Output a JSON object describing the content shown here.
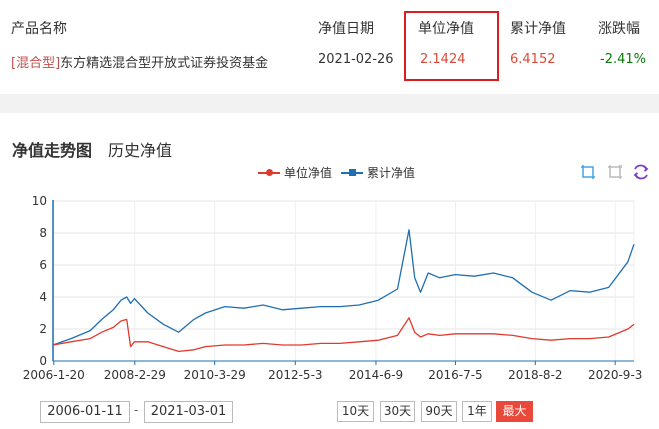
{
  "fund_table": {
    "headers": {
      "name": "产品名称",
      "date": "净值日期",
      "unit_nav": "单位净值",
      "acc_nav": "累计净值",
      "change": "涨跌幅"
    },
    "row": {
      "tag": "[混合型]",
      "name": "东方精选混合型开放式证券投资基金",
      "date": "2021-02-26",
      "unit_nav": "2.1424",
      "acc_nav": "6.4152",
      "change": "-2.41%"
    }
  },
  "chart_section": {
    "title": "净值走势图",
    "history_link": "历史净值"
  },
  "legend": {
    "unit": "单位净值",
    "acc": "累计净值"
  },
  "colors": {
    "unit_series": "#e03a2e",
    "acc_series": "#1f6fb2",
    "highlight_box": "#d81e1e",
    "change_negative": "#0a7a0a",
    "active_button": "#e8493b"
  },
  "toolbar_icons": [
    "zoom-icon",
    "zoom-reset-icon",
    "restore-icon"
  ],
  "date_range": {
    "start": "2006-01-11",
    "separator": "-",
    "end": "2021-03-01"
  },
  "range_buttons": [
    {
      "label": "10天",
      "active": false
    },
    {
      "label": "30天",
      "active": false
    },
    {
      "label": "90天",
      "active": false
    },
    {
      "label": "1年",
      "active": false
    },
    {
      "label": "最大",
      "active": true
    }
  ],
  "chart_data": {
    "type": "line",
    "ylim": [
      0,
      10
    ],
    "y_ticks": [
      "0",
      "2",
      "4",
      "6",
      "8",
      "10"
    ],
    "x_tick_labels": [
      "2006-1-20",
      "2008-2-29",
      "2010-3-29",
      "2012-5-3",
      "2014-6-9",
      "2016-7-5",
      "2018-8-2",
      "2020-9-3"
    ],
    "x_tick_dates": [
      2006.05,
      2008.16,
      2010.24,
      2012.34,
      2014.44,
      2016.51,
      2018.59,
      2020.67
    ],
    "x_range": [
      2006.03,
      2021.16
    ],
    "grid": true,
    "series": [
      {
        "name": "单位净值",
        "x": [
          2006.03,
          2006.5,
          2007.0,
          2007.3,
          2007.6,
          2007.8,
          2007.95,
          2008.05,
          2008.15,
          2008.5,
          2008.9,
          2009.3,
          2009.7,
          2010.0,
          2010.5,
          2011.0,
          2011.5,
          2012.0,
          2012.5,
          2013.0,
          2013.5,
          2014.0,
          2014.5,
          2015.0,
          2015.3,
          2015.45,
          2015.6,
          2015.8,
          2016.1,
          2016.5,
          2017.0,
          2017.5,
          2018.0,
          2018.5,
          2019.0,
          2019.5,
          2020.0,
          2020.5,
          2021.0,
          2021.16
        ],
        "values": [
          1.0,
          1.2,
          1.4,
          1.8,
          2.1,
          2.5,
          2.6,
          0.9,
          1.2,
          1.2,
          0.9,
          0.6,
          0.7,
          0.9,
          1.0,
          1.0,
          1.1,
          1.0,
          1.0,
          1.1,
          1.1,
          1.2,
          1.3,
          1.6,
          2.7,
          1.8,
          1.5,
          1.7,
          1.6,
          1.7,
          1.7,
          1.7,
          1.6,
          1.4,
          1.3,
          1.4,
          1.4,
          1.5,
          2.0,
          2.3
        ]
      },
      {
        "name": "累计净值",
        "x": [
          2006.03,
          2006.5,
          2007.0,
          2007.3,
          2007.6,
          2007.8,
          2007.95,
          2008.05,
          2008.15,
          2008.5,
          2008.9,
          2009.3,
          2009.7,
          2010.0,
          2010.5,
          2011.0,
          2011.5,
          2012.0,
          2012.5,
          2013.0,
          2013.5,
          2014.0,
          2014.5,
          2015.0,
          2015.3,
          2015.45,
          2015.6,
          2015.8,
          2016.1,
          2016.5,
          2017.0,
          2017.5,
          2018.0,
          2018.5,
          2019.0,
          2019.5,
          2020.0,
          2020.5,
          2021.0,
          2021.16
        ],
        "values": [
          1.0,
          1.4,
          1.9,
          2.6,
          3.2,
          3.8,
          4.0,
          3.6,
          3.9,
          3.0,
          2.3,
          1.8,
          2.6,
          3.0,
          3.4,
          3.3,
          3.5,
          3.2,
          3.3,
          3.4,
          3.4,
          3.5,
          3.8,
          4.5,
          8.2,
          5.2,
          4.3,
          5.5,
          5.2,
          5.4,
          5.3,
          5.5,
          5.2,
          4.3,
          3.8,
          4.4,
          4.3,
          4.6,
          6.2,
          7.3
        ]
      }
    ]
  }
}
